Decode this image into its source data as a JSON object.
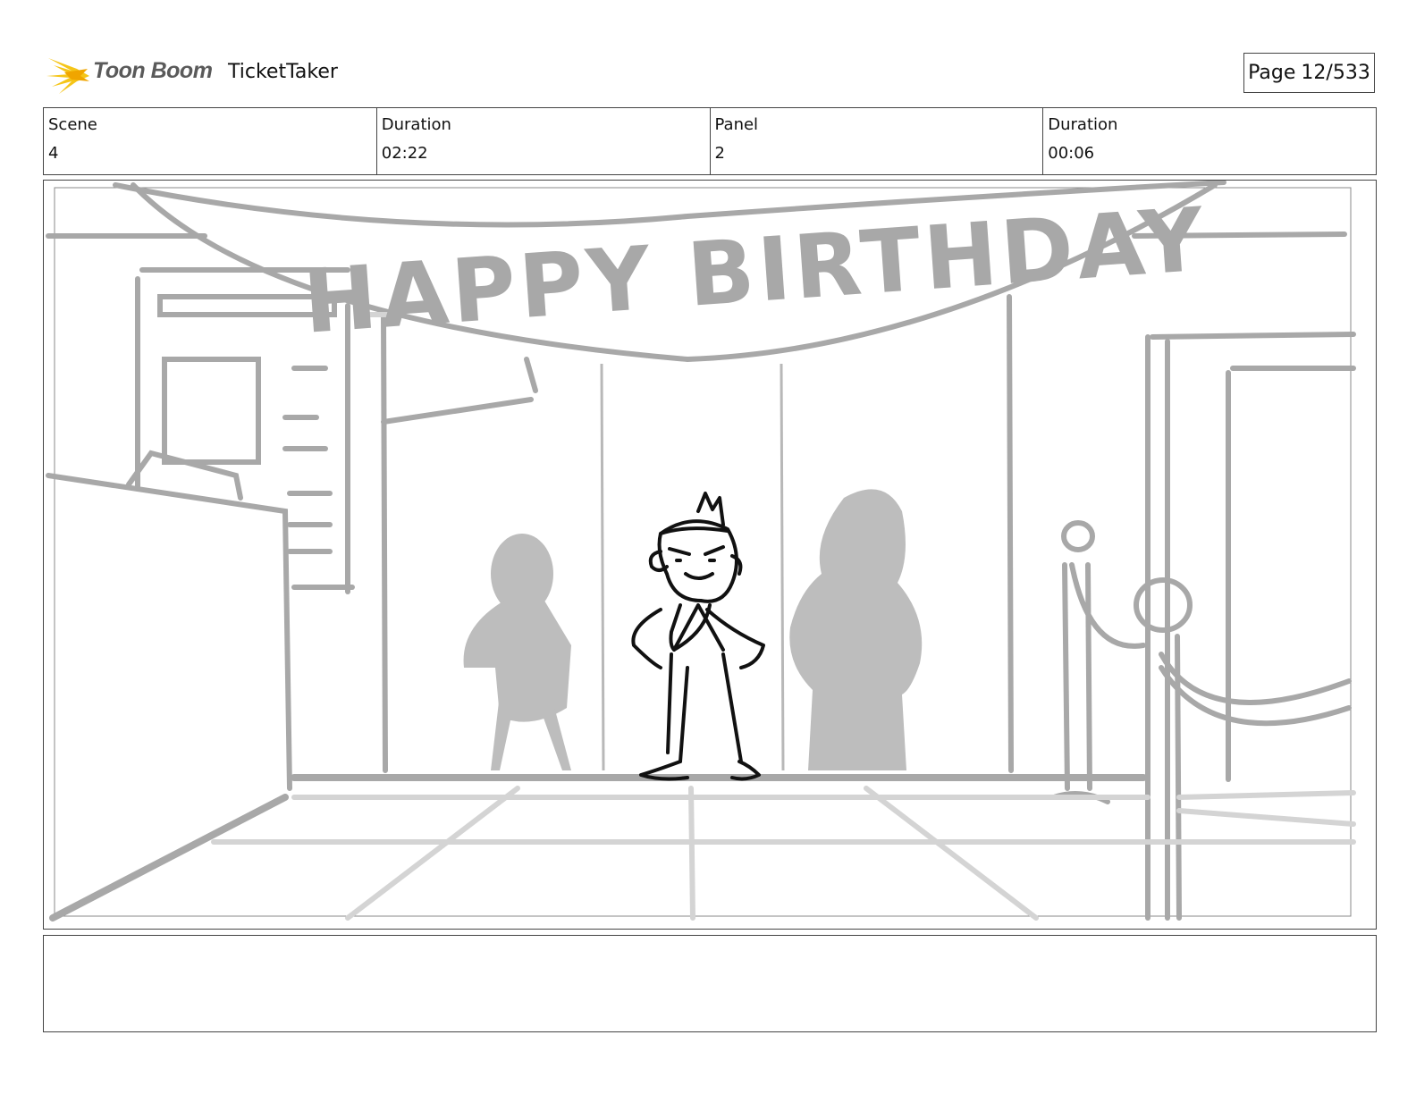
{
  "header": {
    "logo_text": "Toon Boom",
    "project_title": "TicketTaker",
    "page_label": "Page",
    "page_number": "12/533"
  },
  "info": {
    "scene_label": "Scene",
    "scene_value": "4",
    "scene_duration_label": "Duration",
    "scene_duration_value": "02:22",
    "panel_label": "Panel",
    "panel_value": "2",
    "panel_duration_label": "Duration",
    "panel_duration_value": "00:06"
  },
  "panel": {
    "banner_text": "HAPPY BIRTHDAY"
  },
  "notes": {
    "text": ""
  },
  "colors": {
    "sketch_gray": "#a8a8a8",
    "light_gray": "#d4d4d4",
    "silhouette": "#bdbdbd",
    "ink": "#111111",
    "logo_yellow": "#f5c518"
  }
}
